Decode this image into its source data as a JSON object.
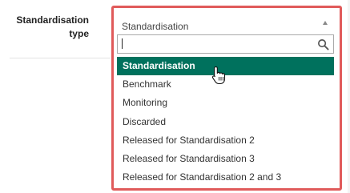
{
  "field": {
    "label_line1": "Standardisation",
    "label_line2": "type"
  },
  "select": {
    "value": "Standardisation",
    "caret_icon": "caret-up-icon"
  },
  "search": {
    "value": "",
    "placeholder": "",
    "icon": "search-icon"
  },
  "options": [
    {
      "label": "Standardisation",
      "selected": true
    },
    {
      "label": "Benchmark",
      "selected": false
    },
    {
      "label": "Monitoring",
      "selected": false
    },
    {
      "label": "Discarded",
      "selected": false
    },
    {
      "label": "Released for Standardisation 2",
      "selected": false
    },
    {
      "label": "Released for Standardisation 3",
      "selected": false
    },
    {
      "label": "Released for Standardisation 2 and 3",
      "selected": false
    }
  ],
  "colors": {
    "selected_bg": "#00715d",
    "highlight_border": "#e05a5a",
    "text": "#333333"
  }
}
